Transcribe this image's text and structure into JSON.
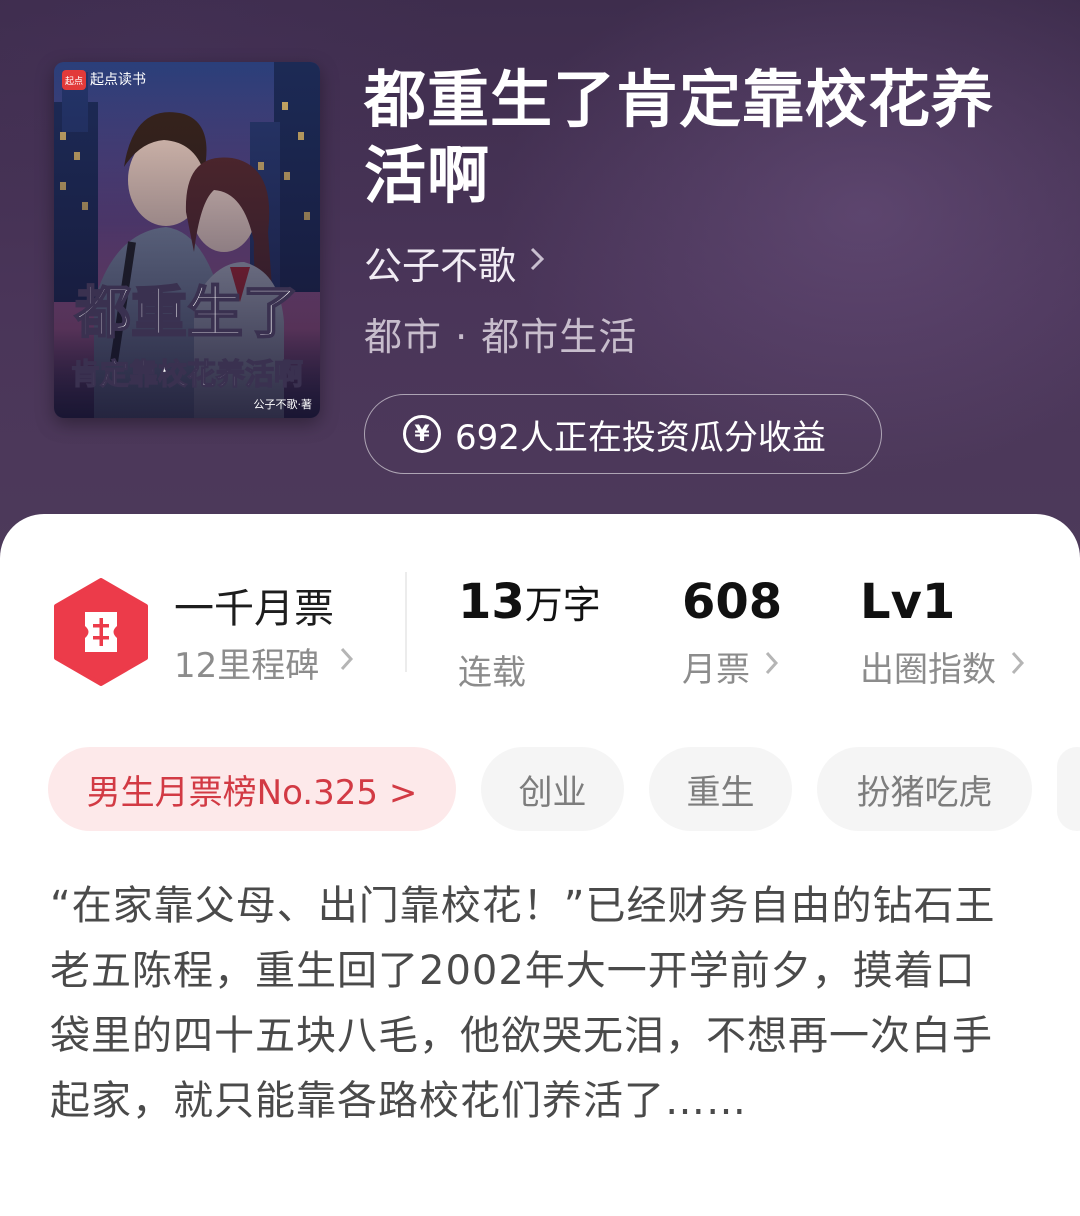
{
  "book": {
    "title": "都重生了肯定靠校花养活啊",
    "author": "公子不歌",
    "genre": "都市 · 都市生活",
    "invest_text": "692人正在投资瓜分收益",
    "cover": {
      "brand_badge": "起点",
      "brand_name": "起点读书",
      "title_line1": "都重生了",
      "title_line2": "肯定靠校花养活啊",
      "author_credit": "公子不歌·著"
    }
  },
  "stats": {
    "milestone_title": "一千月票",
    "milestone_sub": "12里程碑",
    "words_value": "13",
    "words_unit": "万字",
    "words_label": "连载",
    "monthly_value": "608",
    "monthly_label": "月票",
    "index_value": "Lv1",
    "index_label": "出圈指数"
  },
  "tags": {
    "rank": "男生月票榜No.325 >",
    "items": [
      "创业",
      "重生",
      "扮猪吃虎"
    ]
  },
  "synopsis": "“在家靠父母、出门靠校花！”已经财务自由的钻石王老五陈程，重生回了2002年大一开学前夕，摸着口袋里的四十五块八毛，他欲哭无泪，不想再一次白手起家，就只能靠各路校花们养活了……",
  "colors": {
    "header_bg": "#3e2d4d",
    "rank_red": "#d23a44",
    "badge_red": "#ec3b4a"
  },
  "icons": [
    "yen-icon",
    "ticket-icon",
    "chevron-right-icon"
  ]
}
